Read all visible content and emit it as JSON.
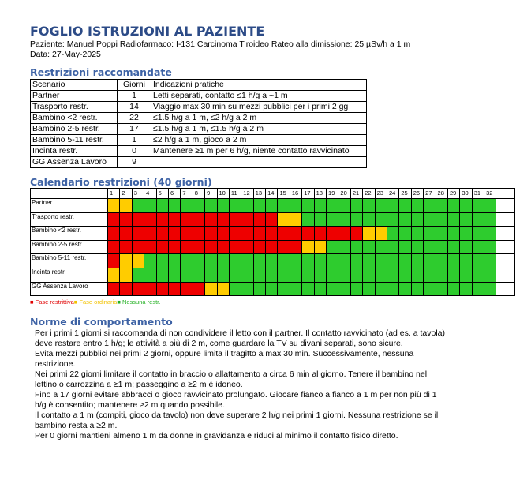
{
  "header": {
    "title": "FOGLIO ISTRUZIONI AL PAZIENTE",
    "info_line": "Paziente: Manuel Poppi Radiofarmaco: I-131 Carcinoma Tiroideo Rateo alla dimissione: 25 µSv/h a 1 m",
    "date_line": "Data: 27-May-2025"
  },
  "restrictions": {
    "section_title": "Restrizioni raccomandate",
    "columns": [
      "Scenario",
      "Giorni",
      "Indicazioni pratiche"
    ],
    "rows": [
      {
        "scenario": "Partner",
        "days": "1",
        "notes": "Letti separati, contatto ≤1 h/g a ~1 m"
      },
      {
        "scenario": "Trasporto restr.",
        "days": "14",
        "notes": "Viaggio max 30 min su mezzi pubblici per i primi 2 gg"
      },
      {
        "scenario": "Bambino <2 restr.",
        "days": "22",
        "notes": "≤1.5 h/g a 1 m, ≤2 h/g a 2 m"
      },
      {
        "scenario": "Bambino 2-5 restr.",
        "days": "17",
        "notes": "≤1.5 h/g a 1 m, ≤1.5 h/g a 2 m"
      },
      {
        "scenario": "Bambino 5-11 restr.",
        "days": "1",
        "notes": "≤2 h/g a 1 m, gioco a 2 m"
      },
      {
        "scenario": "Incinta restr.",
        "days": "0",
        "notes": "Mantenere ≥1 m per 6 h/g, niente contatto ravvicinato"
      },
      {
        "scenario": "GG Assenza Lavoro",
        "days": "9",
        "notes": ""
      }
    ]
  },
  "calendar": {
    "section_title": "Calendario restrizioni (40 giorni)",
    "days": [
      "1",
      "2",
      "3",
      "4",
      "5",
      "6",
      "7",
      "8",
      "9",
      "10",
      "11",
      "12",
      "13",
      "14",
      "15",
      "16",
      "17",
      "18",
      "19",
      "20",
      "21",
      "22",
      "23",
      "24",
      "25",
      "26",
      "27",
      "28",
      "29",
      "30",
      "31",
      "32"
    ],
    "colors": {
      "red": "#ee0000",
      "yellow": "#ffcc00",
      "green": "#2ecc2e"
    },
    "rows": [
      {
        "label": "Partner",
        "red": 0,
        "yellow": 2
      },
      {
        "label": "Trasporto restr.",
        "red": 14,
        "yellow": 2
      },
      {
        "label": "Bambino <2 restr.",
        "red": 21,
        "yellow": 2
      },
      {
        "label": "Bambino 2-5 restr.",
        "red": 16,
        "yellow": 2
      },
      {
        "label": "Bambino 5-11 restr.",
        "red": 1,
        "yellow": 2
      },
      {
        "label": "Incinta restr.",
        "red": 0,
        "yellow": 2
      },
      {
        "label": "GG Assenza Lavoro",
        "red": 8,
        "yellow": 2
      }
    ],
    "legend": {
      "red": "■ Fase restrittiva",
      "yellow": "■ Fase ordinaria",
      "green": "■ Nessuna restr."
    }
  },
  "rules": {
    "section_title": "Norme di comportamento",
    "paragraphs": [
      "Per i primi 1 giorni si raccomanda di non condividere il letto con il partner. Il contatto ravvicinato (ad es. a tavola) deve restare entro 1 h/g; le attività a più di 2 m, come guardare la TV su divani separati, sono sicure.",
      "Evita mezzi pubblici nei primi 2 giorni, oppure limita il tragitto a max 30 min. Successivamente, nessuna restrizione.",
      "Nei primi 22 giorni limitare il contatto in braccio o allattamento a circa 6 min al giorno. Tenere il bambino nel lettino o carrozzina a ≥1 m; passeggino a ≥2 m è idoneo.",
      "Fino a 17 giorni evitare abbracci o gioco ravvicinato prolungato. Giocare fianco a fianco a 1 m per non più di 1 h/g è consentito; mantenere ≥2 m quando possibile.",
      "Il contatto a 1 m (compiti, gioco da tavolo) non deve superare 2 h/g nei primi 1 giorni. Nessuna restrizione se il bambino resta a ≥2 m.",
      "Per 0 giorni mantieni almeno 1 m da donne in gravidanza e riduci al minimo il contatto fisico diretto."
    ]
  }
}
